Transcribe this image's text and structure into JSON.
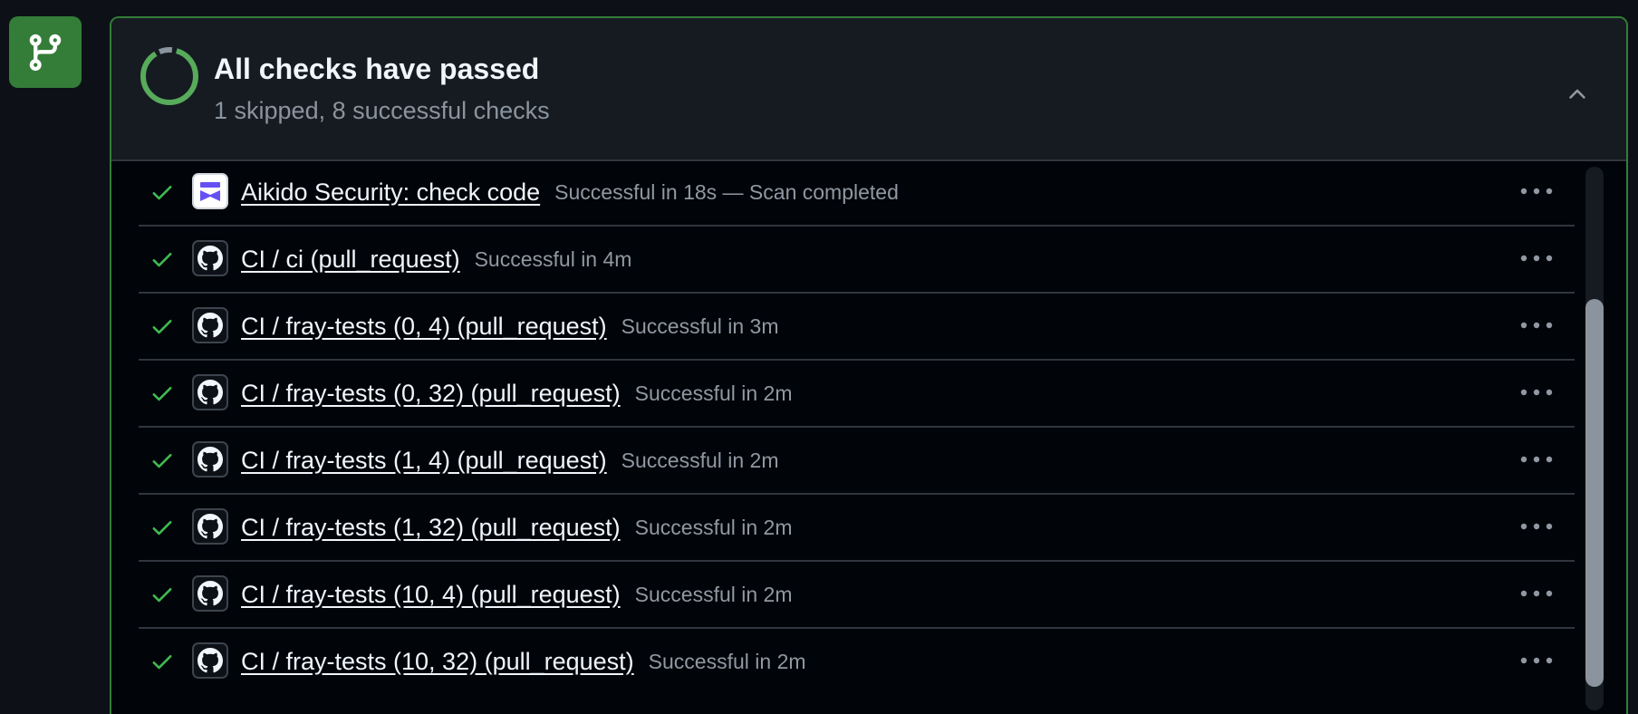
{
  "header": {
    "title": "All checks have passed",
    "subtitle": "1 skipped, 8 successful checks"
  },
  "colors": {
    "success": "#3fb950",
    "merge_badge": "#347d39",
    "panel_border": "#347d39"
  },
  "icons": {
    "merge_badge": "git-branch-icon",
    "collapse": "chevron-up-icon",
    "status": "check-icon",
    "more": "kebab-horizontal-icon"
  },
  "checks": [
    {
      "name": "Aikido Security: check code",
      "desc": "Successful in 18s — Scan completed",
      "app_icon": "aikido-icon"
    },
    {
      "name": "CI / ci (pull_request)",
      "desc": "Successful in 4m",
      "app_icon": "github-icon"
    },
    {
      "name": "CI / fray-tests (0, 4) (pull_request)",
      "desc": "Successful in 3m",
      "app_icon": "github-icon"
    },
    {
      "name": "CI / fray-tests (0, 32) (pull_request)",
      "desc": "Successful in 2m",
      "app_icon": "github-icon"
    },
    {
      "name": "CI / fray-tests (1, 4) (pull_request)",
      "desc": "Successful in 2m",
      "app_icon": "github-icon"
    },
    {
      "name": "CI / fray-tests (1, 32) (pull_request)",
      "desc": "Successful in 2m",
      "app_icon": "github-icon"
    },
    {
      "name": "CI / fray-tests (10, 4) (pull_request)",
      "desc": "Successful in 2m",
      "app_icon": "github-icon"
    },
    {
      "name": "CI / fray-tests (10, 32) (pull_request)",
      "desc": "Successful in 2m",
      "app_icon": "github-icon"
    }
  ]
}
